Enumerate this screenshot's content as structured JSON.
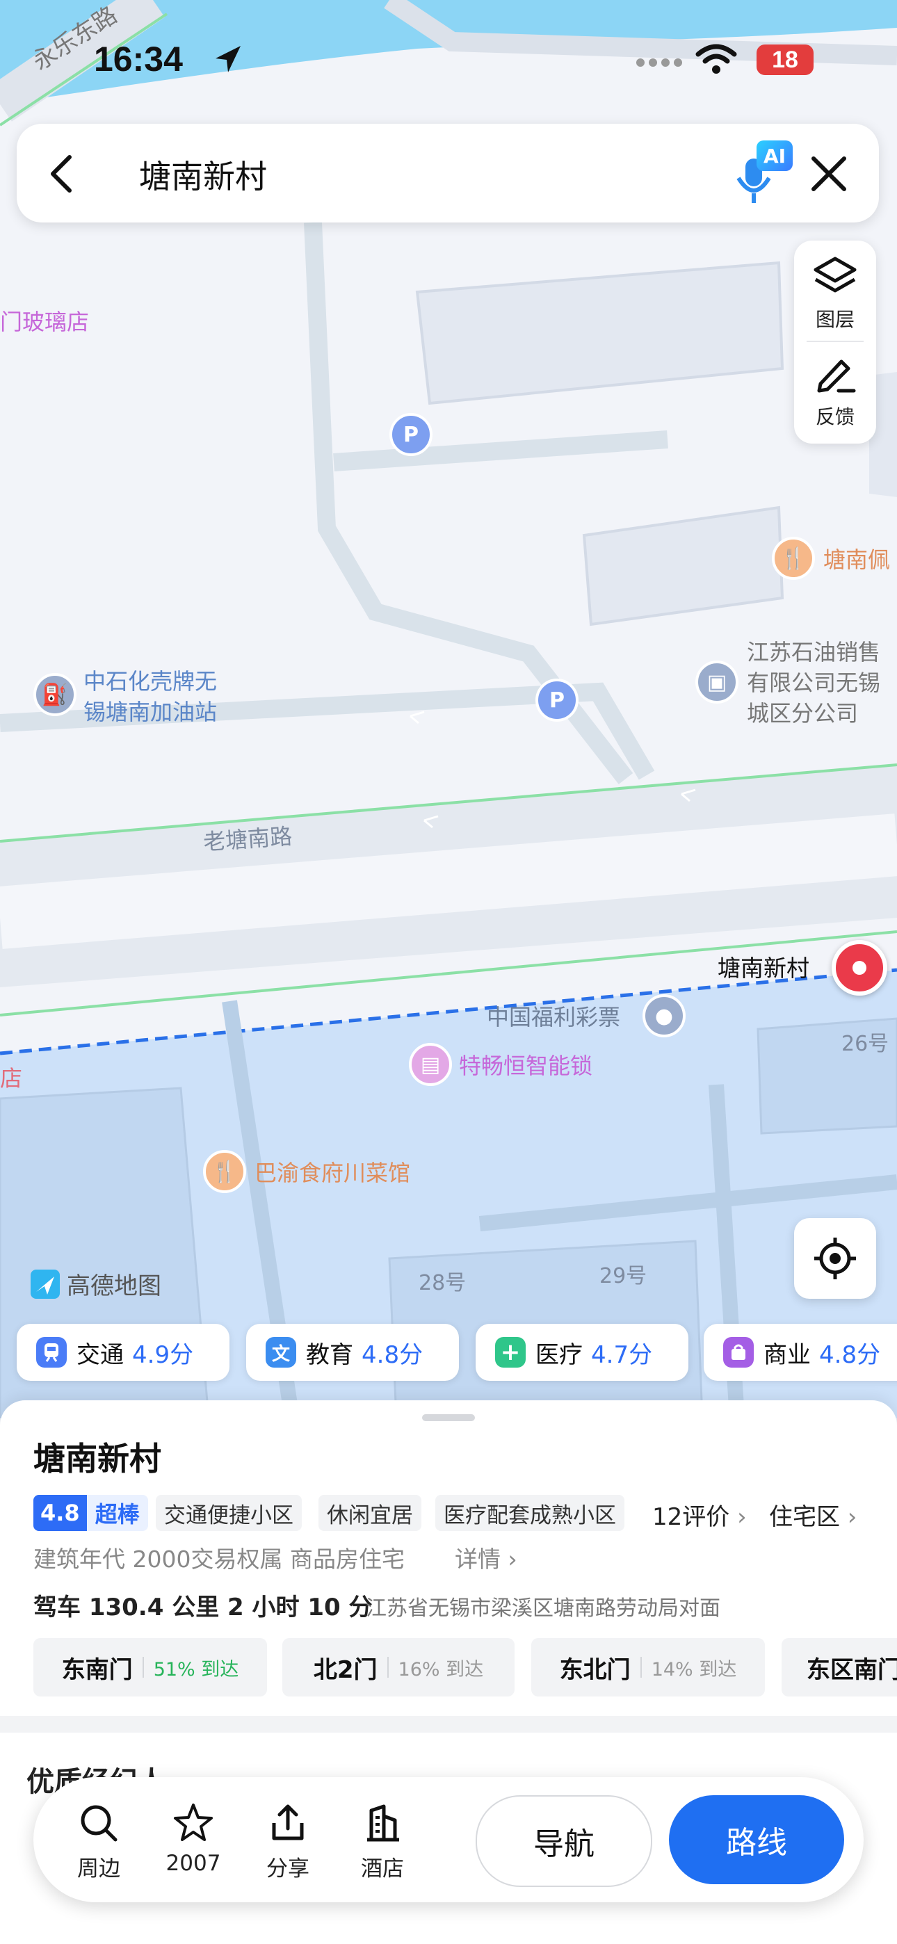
{
  "status_bar": {
    "time": "16:34",
    "battery": "18"
  },
  "search": {
    "query": "塘南新村"
  },
  "tools": {
    "layers_label": "图层",
    "feedback_label": "反馈",
    "ai_badge": "AI"
  },
  "map": {
    "road_top": "永乐东路",
    "road_middle": "老塘南路",
    "poi_glass": "门玻璃店",
    "poi_gas": "中石化壳牌无\n锡塘南加油站",
    "poi_gas_line1": "中石化壳牌无",
    "poi_gas_line2": "锡塘南加油站",
    "poi_jiangsu_line1": "江苏石油销售",
    "poi_jiangsu_line2": "有限公司无锡",
    "poi_jiangsu_line3": "城区分公司",
    "poi_tangnan_pei": "塘南佩",
    "selected_place": "塘南新村",
    "poi_lottery": "中国福利彩票",
    "poi_lock": "特畅恒智能锁",
    "poi_restaurant": "巴渝食府川菜馆",
    "left_fragment": "店",
    "building_26": "26号",
    "building_28": "28号",
    "building_29": "29号",
    "parking_symbol": "P",
    "brand": "高德地图"
  },
  "scores": [
    {
      "label": "交通",
      "score": "4.9分",
      "icon": "train-icon",
      "color": "#4a7cf7"
    },
    {
      "label": "教育",
      "score": "4.8分",
      "icon": "education-icon",
      "color": "#3b8df0",
      "glyph": "文"
    },
    {
      "label": "医疗",
      "score": "4.7分",
      "icon": "medical-icon",
      "color": "#2fc68a",
      "glyph": "+"
    },
    {
      "label": "商业",
      "score": "4.8分",
      "icon": "shopping-icon",
      "color": "#a45ee5"
    }
  ],
  "place": {
    "title": "塘南新村",
    "rating": "4.8",
    "rating_word": "超棒",
    "tags": [
      "交通便捷小区",
      "休闲宜居",
      "医疗配套成熟小区"
    ],
    "reviews": "12评价",
    "category": "住宅区",
    "build_info": "建筑年代 2000交易权属 商品房住宅",
    "details": "详情",
    "drive_info": "驾车 130.4 公里 2 小时 10 分",
    "address": "江苏省无锡市梁溪区塘南路劳动局对面",
    "gates": [
      {
        "name": "东南门",
        "pct": "51% 到达",
        "highlight": true
      },
      {
        "name": "北2门",
        "pct": "16% 到达",
        "highlight": false
      },
      {
        "name": "东北门",
        "pct": "14% 到达",
        "highlight": false
      },
      {
        "name": "东区南门",
        "pct": "",
        "highlight": false
      }
    ],
    "agents_title": "优质经纪人"
  },
  "toolbar": {
    "nearby": "周边",
    "favorites": "2007",
    "share": "分享",
    "hotel": "酒店",
    "navigate": "导航",
    "route": "路线"
  },
  "colors": {
    "accent": "#1f6ff2",
    "score_blue": "#2d6cf6",
    "pin_red": "#ea3a4a",
    "green_pct": "#27b45a"
  }
}
